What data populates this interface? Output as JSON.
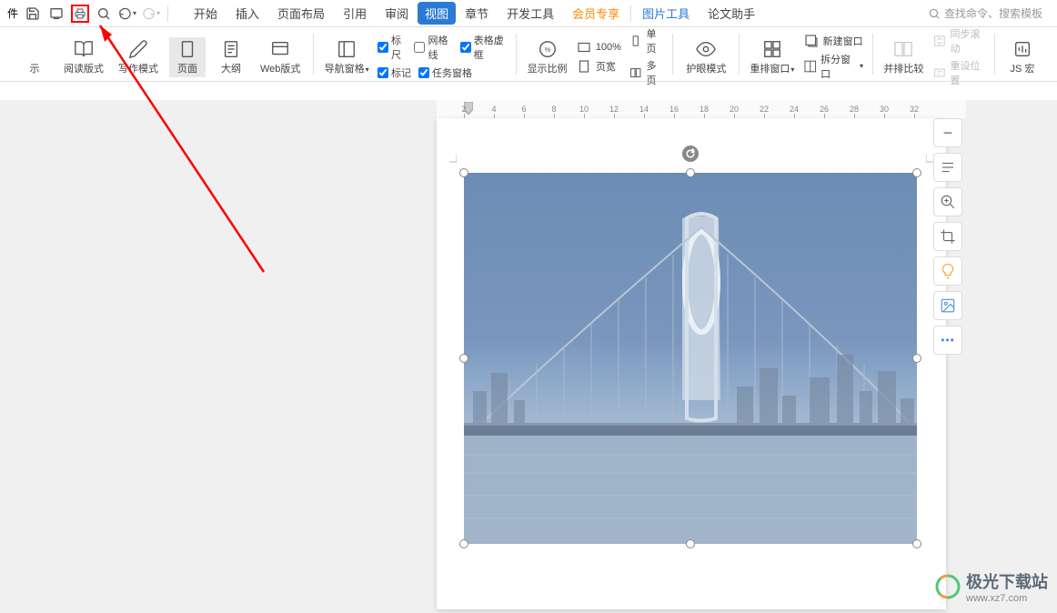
{
  "quick": {
    "file_label": "件"
  },
  "tabs": {
    "start": "开始",
    "insert": "插入",
    "page_layout": "页面布局",
    "reference": "引用",
    "review": "审阅",
    "view": "视图",
    "chapter": "章节",
    "dev_tools": "开发工具",
    "vip": "会员专享",
    "pic_tools": "图片工具",
    "paper_helper": "论文助手"
  },
  "search": {
    "placeholder": "查找命令、搜索模板"
  },
  "ribbon": {
    "show_label": "示",
    "read_mode": "阅读版式",
    "write_mode": "写作模式",
    "page": "页面",
    "outline": "大纲",
    "web_layout": "Web版式",
    "nav_pane": "导航窗格",
    "ruler": "标尺",
    "gridlines": "网格线",
    "table_dashed": "表格虚框",
    "markup": "标记",
    "task_pane": "任务窗格",
    "display_scale": "显示比例",
    "zoom_100": "100%",
    "single_page": "单页",
    "page_width": "页宽",
    "multi_page": "多页",
    "eye_protect": "护眼模式",
    "rearrange_window": "重排窗口",
    "new_window": "新建窗口",
    "split_window": "拆分窗口",
    "side_by_side": "并排比较",
    "sync_scroll": "同步滚动",
    "reset_position": "重设位置",
    "js_macro": "JS 宏"
  },
  "ruler_ticks": [
    "2",
    "4",
    "6",
    "8",
    "10",
    "12",
    "14",
    "16",
    "18",
    "20",
    "22",
    "24",
    "26",
    "28",
    "30",
    "32"
  ],
  "side_tools": {
    "minus": "−",
    "dots": "•••"
  },
  "watermark": {
    "name": "极光下载站",
    "url": "www.xz7.com"
  }
}
